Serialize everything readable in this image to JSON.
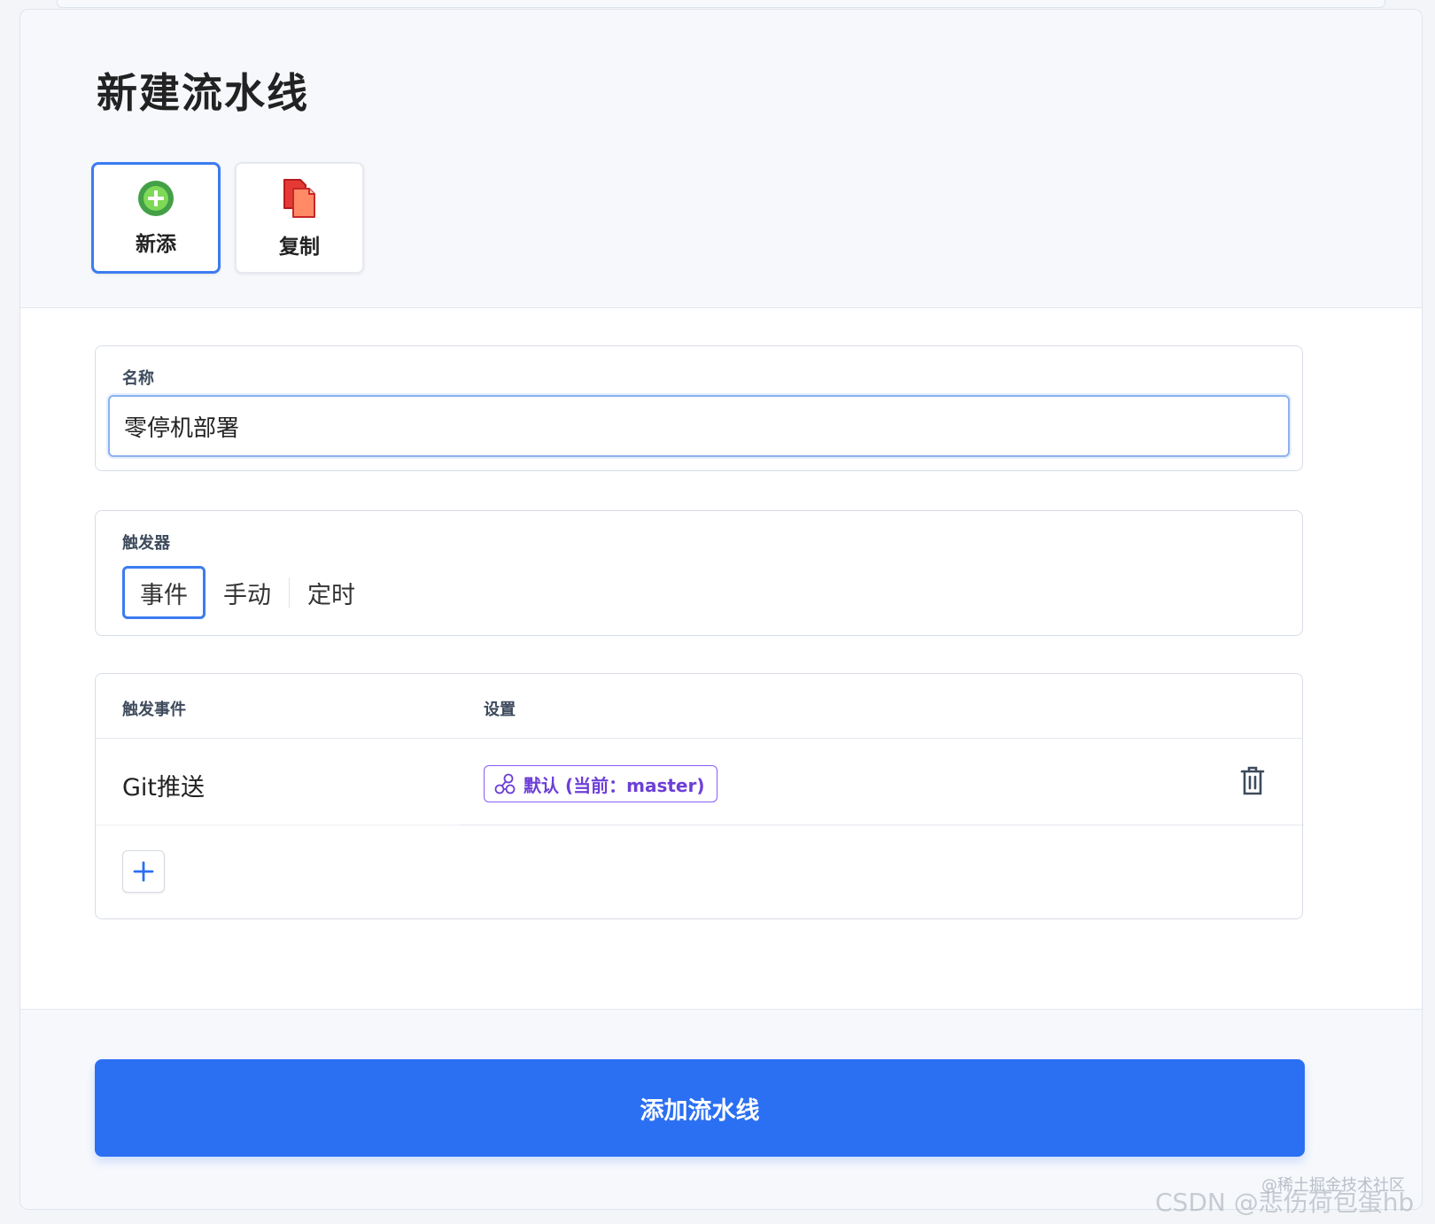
{
  "header": {
    "title": "新建流水线",
    "modes": [
      {
        "label": "新添",
        "icon": "plus-circle-icon",
        "selected": true
      },
      {
        "label": "复制",
        "icon": "copy-documents-icon",
        "selected": false
      }
    ]
  },
  "name_field": {
    "label": "名称",
    "value": "零停机部署"
  },
  "trigger": {
    "label": "触发器",
    "options": [
      "事件",
      "手动",
      "定时"
    ],
    "selected": "事件"
  },
  "events_table": {
    "columns": [
      "触发事件",
      "设置"
    ],
    "rows": [
      {
        "event": "Git推送",
        "setting": "默认 (当前：master)",
        "setting_icon": "branch-icon",
        "action_icon": "trash-icon"
      }
    ],
    "add_icon": "plus-icon"
  },
  "footer": {
    "submit_label": "添加流水线"
  },
  "watermark": {
    "small": "@稀土掘金技术社区",
    "main": "CSDN @悲伤荷包蛋hb"
  },
  "colors": {
    "accent": "#2b6ff3",
    "selected_border": "#3b7cf0",
    "tag_purple": "#6d3fd6",
    "plus_green": "#4caf50",
    "copy_red": "#e53935"
  }
}
